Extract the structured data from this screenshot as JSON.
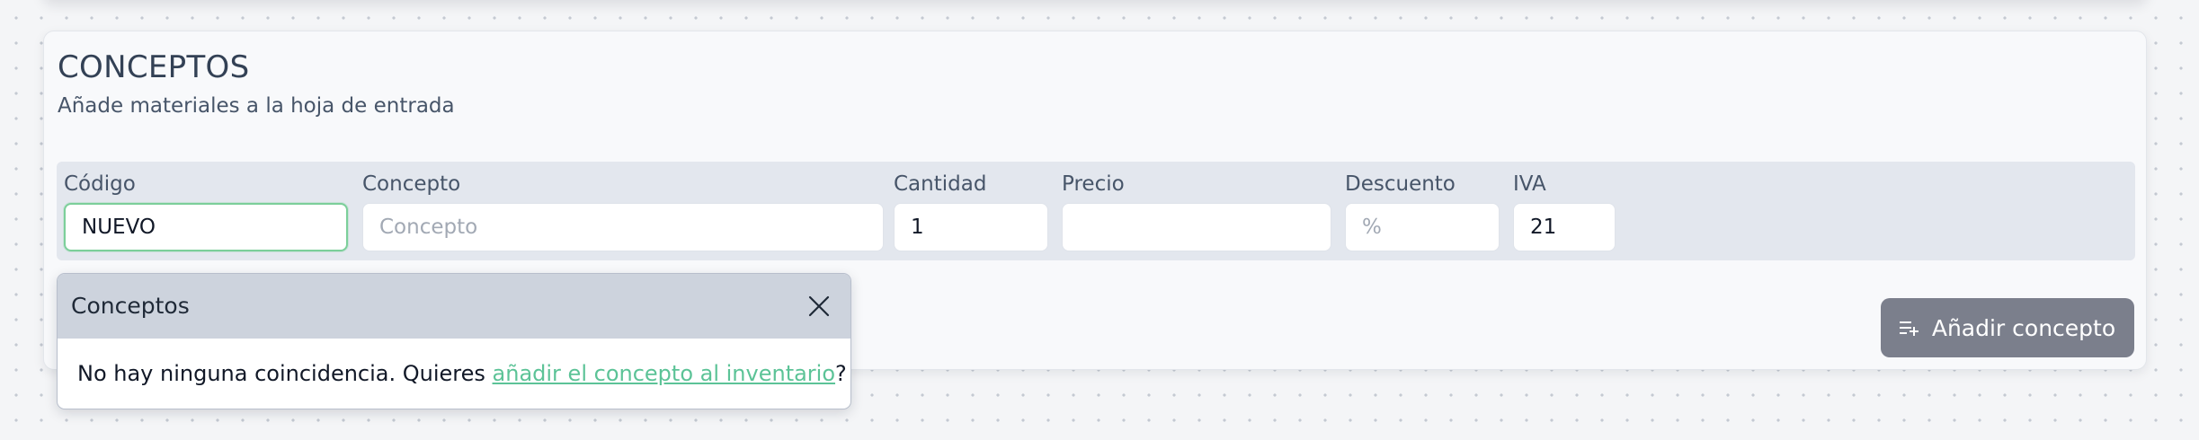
{
  "section": {
    "title": "CONCEPTOS",
    "subtitle": "Añade materiales a la hoja de entrada"
  },
  "form": {
    "codigo": {
      "label": "Código",
      "value": "NUEVO",
      "placeholder": ""
    },
    "concepto": {
      "label": "Concepto",
      "value": "",
      "placeholder": "Concepto"
    },
    "cantidad": {
      "label": "Cantidad",
      "value": "1",
      "placeholder": ""
    },
    "precio": {
      "label": "Precio",
      "value": "",
      "placeholder": ""
    },
    "descuento": {
      "label": "Descuento",
      "value": "",
      "placeholder": "%"
    },
    "iva": {
      "label": "IVA",
      "value": "21",
      "placeholder": ""
    }
  },
  "add_button": {
    "label": "Añadir concepto",
    "icon": "playlist-add-icon"
  },
  "popup": {
    "title": "Conceptos",
    "close_icon": "close-icon",
    "message_prefix": "No hay ninguna coincidencia. Quieres ",
    "link_text": "añadir el concepto al inventario",
    "message_suffix": "?"
  },
  "colors": {
    "active_border": "#7ccf9a",
    "link": "#5cc397",
    "button_bg": "#7b7f8c",
    "popup_header_bg": "#cdd3dd",
    "form_row_bg": "#e3e7ee"
  }
}
